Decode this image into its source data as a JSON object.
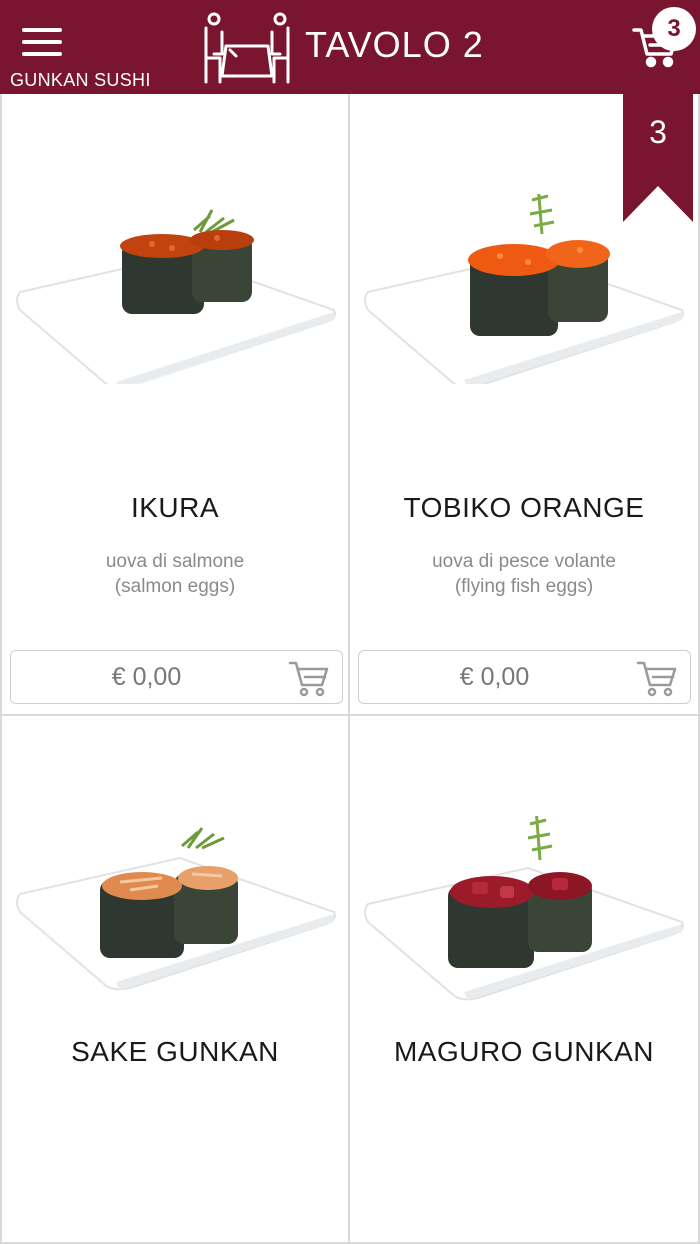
{
  "header": {
    "category": "GUNKAN SUSHI",
    "table_title": "TAVOLO 2",
    "cart_count": "3",
    "brand_color": "#7a1530",
    "icons": [
      "menu-icon",
      "table-icon",
      "cart-icon"
    ]
  },
  "ribbon": {
    "count": "3"
  },
  "items": [
    {
      "name": "IKURA",
      "description_line1": "uova di salmone",
      "description_line2": "(salmon eggs)",
      "price": "€ 0,00",
      "topping": "#c1440f"
    },
    {
      "name": "TOBIKO ORANGE",
      "description_line1": "uova di pesce volante",
      "description_line2": "(flying fish eggs)",
      "price": "€ 0,00",
      "topping": "#ef5a12"
    },
    {
      "name": "SAKE GUNKAN",
      "topping": "#e08a4f"
    },
    {
      "name": "MAGURO GUNKAN",
      "topping": "#9b1b2a"
    }
  ]
}
